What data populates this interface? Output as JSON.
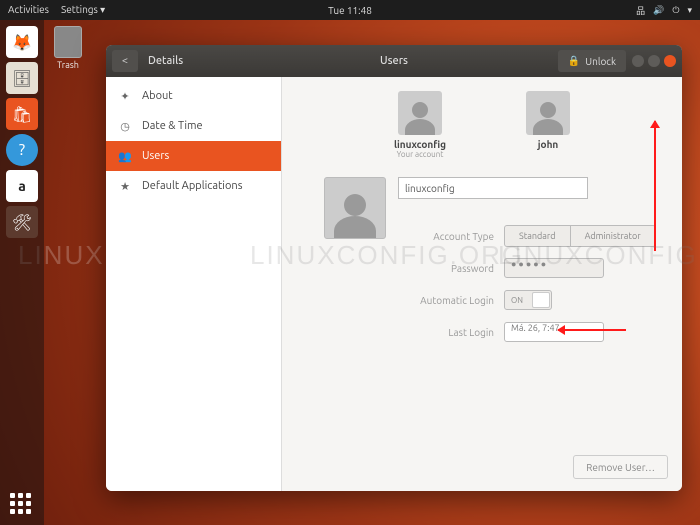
{
  "topbar": {
    "activities": "Activities",
    "settings": "Settings ▾",
    "clock": "Tue 11:48"
  },
  "trash_label": "Trash",
  "window": {
    "section": "Details",
    "title": "Users",
    "unlock": "Unlock"
  },
  "sidebar": {
    "items": [
      {
        "icon": "✦",
        "label": "About"
      },
      {
        "icon": "◷",
        "label": "Date & Time"
      },
      {
        "icon": "👥",
        "label": "Users"
      },
      {
        "icon": "★",
        "label": "Default Applications"
      }
    ]
  },
  "users": [
    {
      "name": "linuxconfig",
      "sub": "Your account"
    },
    {
      "name": "john",
      "sub": ""
    }
  ],
  "detail": {
    "name_value": "linuxconfig",
    "labels": {
      "account_type": "Account Type",
      "password": "Password",
      "auto_login": "Automatic Login",
      "last_login": "Last Login"
    },
    "account_type": {
      "standard": "Standard",
      "admin": "Administrator"
    },
    "password_mask": "●●●●●",
    "toggle_state": "ON",
    "last_login_value": "Má. 26,  7:47",
    "remove": "Remove User…"
  },
  "watermark": "LINUXCONFIG.ORG"
}
